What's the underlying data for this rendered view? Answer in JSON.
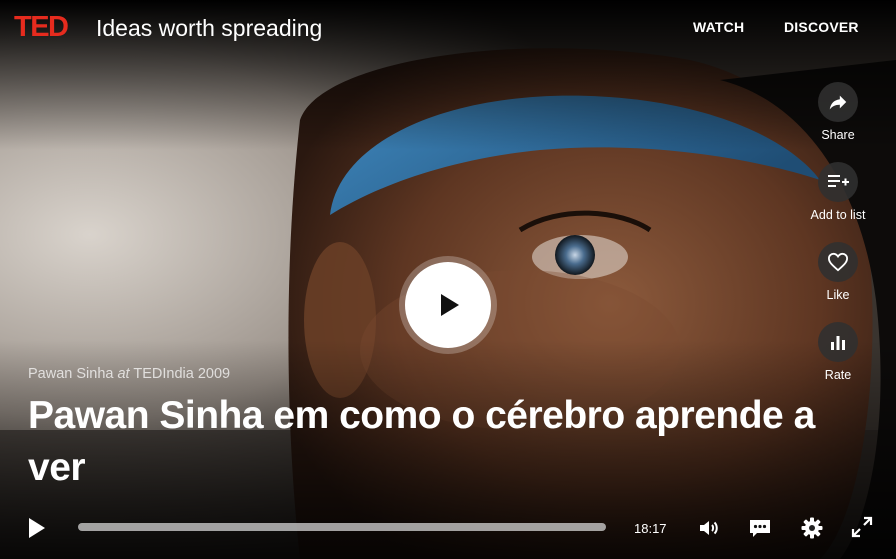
{
  "header": {
    "logo": "TED",
    "tagline": "Ideas worth spreading",
    "nav": {
      "watch": "WATCH",
      "discover": "DISCOVER"
    }
  },
  "actions": {
    "share": "Share",
    "add_to_list": "Add to list",
    "like": "Like",
    "rate": "Rate"
  },
  "talk": {
    "speaker": "Pawan Sinha",
    "at": "at",
    "event": "TEDIndia 2009",
    "title": "Pawan Sinha em como o cérebro aprende a ver"
  },
  "player": {
    "duration": "18:17",
    "progress": 0
  },
  "colors": {
    "brand": "#e62b1e",
    "text": "#ffffff"
  }
}
